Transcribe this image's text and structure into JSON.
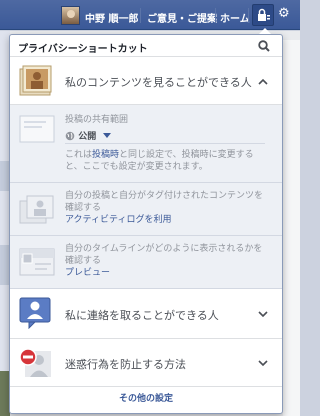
{
  "topbar": {
    "user_name": "中野 順一郎",
    "feedback_label": "ご意見・ご提案",
    "home_label": "ホーム"
  },
  "popover": {
    "title": "プライバシーショートカット",
    "sections": [
      {
        "title": "私のコンテンツを見ることができる人",
        "expanded": true
      },
      {
        "title": "私に連絡を取ることができる人",
        "expanded": false
      },
      {
        "title": "迷惑行為を防止する方法",
        "expanded": false
      }
    ],
    "audience": {
      "label": "投稿の共有範囲",
      "value": "公開",
      "note_line1_prefix": "これは",
      "note_link": "投稿時",
      "note_line1_suffix": "と同じ設定で、投稿時に変更する",
      "note_line2": "と、ここでも設定が変更されます。"
    },
    "tagged": {
      "line1": "自分の投稿と自分がタグ付けされたコンテンツを",
      "line2": "確認する",
      "link": "アクティビティログを利用"
    },
    "timeline": {
      "line1": "自分のタイムラインがどのように表示されるかを",
      "line2": "確認する",
      "link": "プレビュー"
    },
    "footer_link": "その他の設定"
  },
  "colors": {
    "brand": "#3b5998",
    "link": "#3b5998",
    "subpanel": "#edf0f5"
  }
}
